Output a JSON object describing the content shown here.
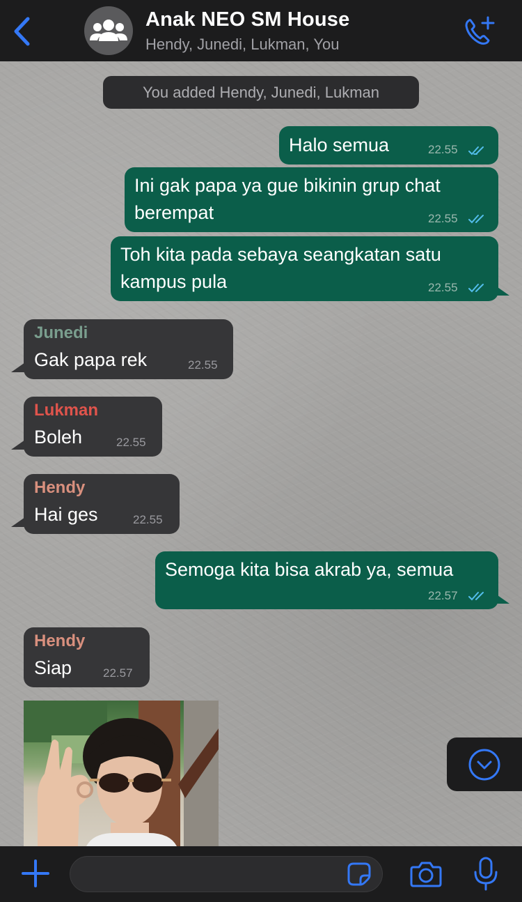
{
  "header": {
    "title": "Anak NEO SM House",
    "subtitle": "Hendy, Junedi, Lukman, You",
    "back_icon": "chevron-left-icon",
    "avatar_icon": "group-icon",
    "call_icon": "phone-plus-icon"
  },
  "system_message": "You added Hendy, Junedi, Lukman",
  "messages": [
    {
      "direction": "out",
      "lines": [
        "Halo semua"
      ],
      "time": "22.55",
      "status": "read"
    },
    {
      "direction": "out",
      "lines": [
        "Ini gak papa ya gue bikinin grup chat",
        "berempat"
      ],
      "time": "22.55",
      "status": "read"
    },
    {
      "direction": "out",
      "lines": [
        "Toh kita pada sebaya seangkatan satu",
        "kampus pula"
      ],
      "time": "22.55",
      "status": "read"
    },
    {
      "direction": "in",
      "sender": "Junedi",
      "sender_color": "#7a9e8e",
      "lines": [
        "Gak papa rek"
      ],
      "time": "22.55"
    },
    {
      "direction": "in",
      "sender": "Lukman",
      "sender_color": "#e0544c",
      "lines": [
        "Boleh"
      ],
      "time": "22.55"
    },
    {
      "direction": "in",
      "sender": "Hendy",
      "sender_color": "#d9907e",
      "lines": [
        "Hai ges"
      ],
      "time": "22.55"
    },
    {
      "direction": "out",
      "lines": [
        "Semoga kita bisa akrab ya, semua"
      ],
      "time": "22.57",
      "status": "read"
    },
    {
      "direction": "in",
      "sender": "Hendy",
      "sender_color": "#d9907e",
      "lines": [
        "Siap"
      ],
      "time": "22.57"
    }
  ],
  "sticker": {
    "icon": "photo-sticker"
  },
  "scroll_button_icon": "chevron-down-circle-icon",
  "composer": {
    "placeholder": "",
    "value": "",
    "icons": [
      "plus-icon",
      "sticker-icon",
      "camera-icon",
      "microphone-icon"
    ]
  },
  "colors": {
    "accent": "#3478f6",
    "outgoing_bubble": "#0b5e4a",
    "incoming_bubble": "#363638",
    "read_tick": "#53bdeb"
  }
}
